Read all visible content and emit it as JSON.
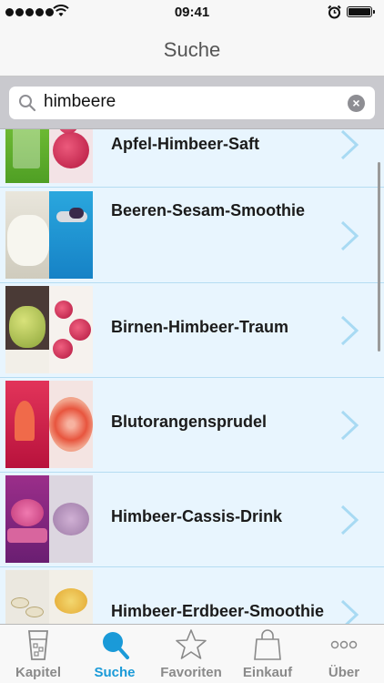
{
  "status_bar": {
    "time": "09:41"
  },
  "nav": {
    "title": "Suche"
  },
  "search": {
    "value": "himbeere"
  },
  "recipes": [
    {
      "label": "Apfel-Himbeer-Saft"
    },
    {
      "label": "Beeren-Sesam-Smoothie"
    },
    {
      "label": "Birnen-Himbeer-Traum"
    },
    {
      "label": "Blutorangensprudel"
    },
    {
      "label": "Himbeer-Cassis-Drink"
    },
    {
      "label": "Himbeer-Erdbeer-Smoothie"
    }
  ],
  "tabs": [
    {
      "label": "Kapitel",
      "icon": "glass-icon"
    },
    {
      "label": "Suche",
      "icon": "search-icon",
      "active": true
    },
    {
      "label": "Favoriten",
      "icon": "star-icon"
    },
    {
      "label": "Einkauf",
      "icon": "shopping-bag-icon"
    },
    {
      "label": "Über",
      "icon": "more-icon"
    }
  ],
  "colors": {
    "accent": "#1a9ad8",
    "row_background": "#e8f5fe",
    "row_separator": "#b5dcf2",
    "chevron": "#a8daf3"
  }
}
